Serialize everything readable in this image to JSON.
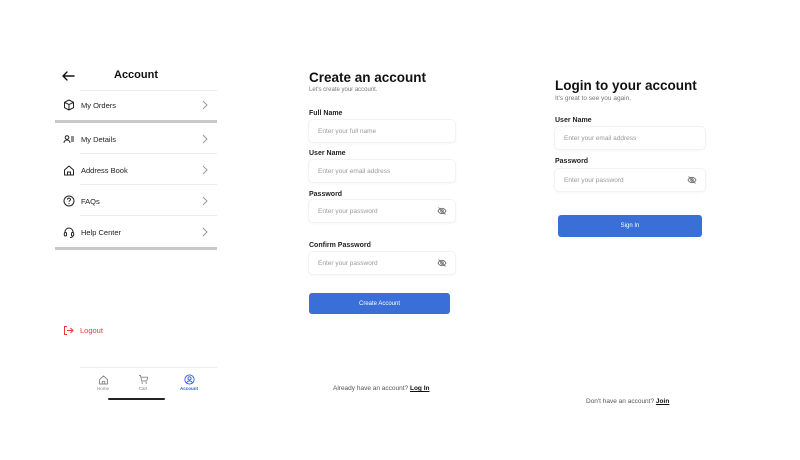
{
  "account": {
    "title": "Account",
    "menu": [
      {
        "label": "My Orders",
        "icon": "box-icon"
      },
      {
        "label": "My Details",
        "icon": "id-card-icon"
      },
      {
        "label": "Address Book",
        "icon": "house-icon"
      },
      {
        "label": "FAQs",
        "icon": "question-circle-icon"
      },
      {
        "label": "Help Center",
        "icon": "headset-icon"
      }
    ],
    "logout_label": "Logout",
    "tabs": [
      {
        "label": "Home",
        "icon": "home-icon"
      },
      {
        "label": "Cart",
        "icon": "cart-icon"
      },
      {
        "label": "Account",
        "icon": "user-circle-icon"
      }
    ],
    "logout_color": "#e53935",
    "active_color": "#2b5fd0"
  },
  "signup": {
    "title": "Create an account",
    "subtitle": "Let's create your account.",
    "fullname_label": "Full Name",
    "fullname_placeholder": "Enter your full name",
    "username_label": "User Name",
    "username_placeholder": "Enter your email address",
    "password_label": "Password",
    "password_placeholder": "Enter your password",
    "confirm_label": "Confirm Password",
    "confirm_placeholder": "Enter your password",
    "button_label": "Create Account",
    "footer_text": "Already have an account?",
    "footer_link": "Log In"
  },
  "login": {
    "title": "Login to your account",
    "subtitle": "It's great to see you again.",
    "username_label": "User Name",
    "username_placeholder": "Enter your email address",
    "password_label": "Password",
    "password_placeholder": "Enter your password",
    "button_label": "Sign In",
    "footer_text": "Don't have an account?",
    "footer_link": "Join"
  },
  "theme": {
    "primary": "#3a6fd8"
  }
}
